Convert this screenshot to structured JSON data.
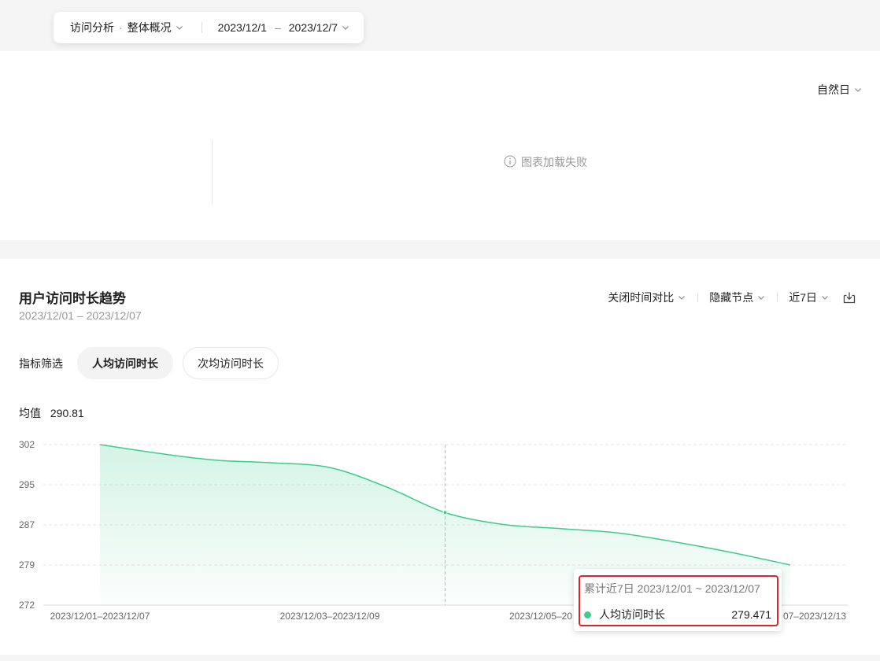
{
  "filter_bar": {
    "analysis_type": "访问分析",
    "dot": "·",
    "overview": "整体概况",
    "date_start": "2023/12/1",
    "date_sep": "–",
    "date_end": "2023/12/7"
  },
  "overview_card": {
    "granularity": "自然日",
    "load_error": "图表加载失败"
  },
  "trend_card": {
    "title": "用户访问时长趋势",
    "date_range": "2023/12/01 – 2023/12/07",
    "toolbar": {
      "compare": "关闭时间对比",
      "nodes": "隐藏节点",
      "period": "近7日"
    },
    "metric_filter": {
      "label": "指标筛选",
      "options": [
        "人均访问时长",
        "次均访问时长"
      ],
      "selected": "人均访问时长"
    },
    "average": {
      "label": "均值",
      "value": "290.81"
    },
    "tooltip": {
      "header": "累计近7日 2023/12/01 ~ 2023/12/07",
      "series_name": "人均访问时长",
      "value": "279.471"
    }
  },
  "chart_data": {
    "type": "area",
    "y_ticks": [
      "302",
      "295",
      "287",
      "279",
      "272"
    ],
    "x_tick_labels": [
      "2023/12/01–2023/12/07",
      "2023/12/03–2023/12/09",
      "2023/12/05–20",
      "07–2023/12/13"
    ],
    "ylim": [
      272,
      302
    ],
    "series": [
      {
        "name": "人均访问时长",
        "points": [
          [
            0,
            302.0
          ],
          [
            0.5,
            300.4
          ],
          [
            1.0,
            299.1
          ],
          [
            1.5,
            298.6
          ],
          [
            2.0,
            297.7
          ],
          [
            2.5,
            294.0
          ],
          [
            3.0,
            289.3
          ],
          [
            3.5,
            287.1
          ],
          [
            4.0,
            286.3
          ],
          [
            4.5,
            285.5
          ],
          [
            5.0,
            283.8
          ],
          [
            5.5,
            281.8
          ],
          [
            6.0,
            279.5
          ]
        ]
      }
    ],
    "line_color": "#3ecb8c",
    "grid": true,
    "hover_index": 6
  }
}
